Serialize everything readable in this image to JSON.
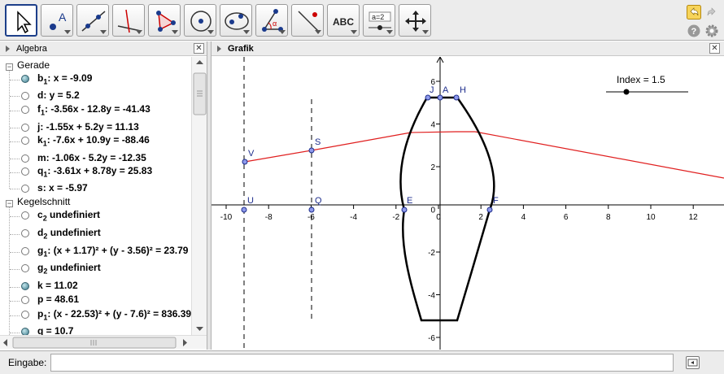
{
  "toolbar": {
    "tools": [
      "move-tool",
      "point-tool",
      "line-tool",
      "perpendicular-tool",
      "polygon-tool",
      "circle-tool",
      "conic-tool",
      "angle-tool",
      "reflect-tool",
      "text-tool",
      "slider-tool",
      "move-view-tool"
    ],
    "text_tool_label": "ABC",
    "slider_tool_label": "a=2"
  },
  "algebra": {
    "title": "Algebra",
    "groups": [
      {
        "label": "Gerade",
        "items": [
          {
            "name": "b",
            "sub": "1",
            "expr": ": x = -9.09",
            "visible": true
          },
          {
            "name": "d",
            "sub": "",
            "expr": ": y = 5.2",
            "visible": false
          },
          {
            "name": "f",
            "sub": "1",
            "expr": ": -3.56x - 12.8y = -41.43",
            "visible": false
          },
          {
            "name": "j",
            "sub": "",
            "expr": ": -1.55x + 5.2y = 11.13",
            "visible": false
          },
          {
            "name": "k",
            "sub": "1",
            "expr": ": -7.6x + 10.9y = -88.46",
            "visible": false
          },
          {
            "name": "m",
            "sub": "",
            "expr": ": -1.06x - 5.2y = -12.35",
            "visible": false
          },
          {
            "name": "q",
            "sub": "1",
            "expr": ": -3.61x + 8.78y = 25.83",
            "visible": false
          },
          {
            "name": "s",
            "sub": "",
            "expr": ": x = -5.97",
            "visible": false
          }
        ]
      },
      {
        "label": "Kegelschnitt",
        "items": [
          {
            "name": "c",
            "sub": "2",
            "expr": " undefiniert",
            "visible": false
          },
          {
            "name": "d",
            "sub": "2",
            "expr": " undefiniert",
            "visible": false
          },
          {
            "name": "g",
            "sub": "1",
            "expr": ": (x + 1.17)² + (y - 3.56)² = 23.79",
            "visible": false
          },
          {
            "name": "g",
            "sub": "2",
            "expr": " undefiniert",
            "visible": false
          },
          {
            "name": "k",
            "sub": "",
            "expr": " = 11.02",
            "visible": true
          },
          {
            "name": "p",
            "sub": "",
            "expr": " = 48.61",
            "visible": false
          },
          {
            "name": "p",
            "sub": "1",
            "expr": ": (x - 22.53)² + (y - 7.6)² = 836.39",
            "visible": false
          },
          {
            "name": "q",
            "sub": "",
            "expr": " = 10.7",
            "visible": true
          }
        ]
      }
    ]
  },
  "graphics": {
    "title": "Grafik",
    "slider_label": "Index = 1.5",
    "x_ticks": [
      "-10",
      "-8",
      "-6",
      "-4",
      "-2",
      "0",
      "2",
      "4",
      "6",
      "8",
      "10",
      "12"
    ],
    "y_ticks": [
      "6",
      "4",
      "2",
      "0",
      "-2",
      "-4",
      "-6"
    ],
    "points": [
      "J",
      "A",
      "H",
      "S",
      "V",
      "E",
      "F",
      "U",
      "Q"
    ]
  },
  "input": {
    "label": "Eingabe:",
    "value": ""
  }
}
